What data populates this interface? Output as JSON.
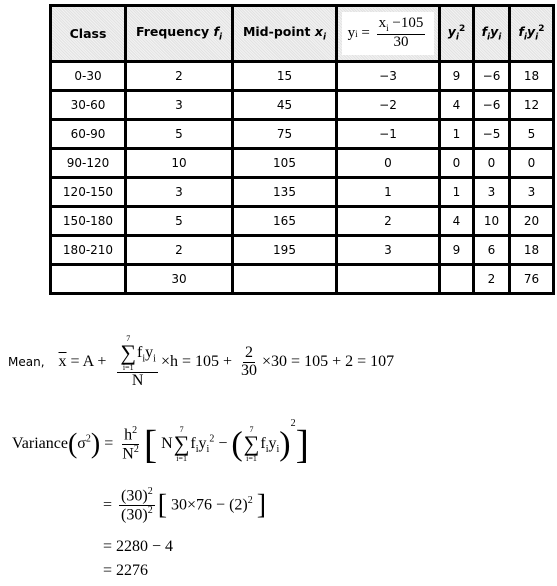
{
  "table": {
    "headers": [
      "Class",
      "Frequency",
      "Mid-point",
      "yi = (xi − 105) / 30",
      "yi²",
      "fiyi",
      "fiyi²"
    ],
    "header_parts": {
      "class": "Class",
      "frequency": "Frequency ",
      "frequency_var": "f",
      "frequency_sub": "i",
      "midpoint": "Mid-point ",
      "midpoint_var": "x",
      "midpoint_sub": "i",
      "y_lhs": "y",
      "y_lhs_sub": "i",
      "y_eq": " = ",
      "y_num_var": "x",
      "y_num_sub": "i",
      "y_num_rest": " −105",
      "y_den": "30",
      "ysq_var": "y",
      "ysq_sub": "i",
      "ysq_sup": "2",
      "fy_f": "f",
      "fy_f_sub": "i",
      "fy_y": "y",
      "fy_y_sub": "i",
      "fysq_f": "f",
      "fysq_f_sub": "i",
      "fysq_y": "y",
      "fysq_y_sub": "i",
      "fysq_sup": "2"
    },
    "rows": [
      {
        "class": "0-30",
        "f": "2",
        "x": "15",
        "y": "−3",
        "y2": "9",
        "fy": "−6",
        "fy2": "18"
      },
      {
        "class": "30-60",
        "f": "3",
        "x": "45",
        "y": "−2",
        "y2": "4",
        "fy": "−6",
        "fy2": "12"
      },
      {
        "class": "60-90",
        "f": "5",
        "x": "75",
        "y": "−1",
        "y2": "1",
        "fy": "−5",
        "fy2": "5"
      },
      {
        "class": "90-120",
        "f": "10",
        "x": "105",
        "y": "0",
        "y2": "0",
        "fy": "0",
        "fy2": "0"
      },
      {
        "class": "120-150",
        "f": "3",
        "x": "135",
        "y": "1",
        "y2": "1",
        "fy": "3",
        "fy2": "3"
      },
      {
        "class": "150-180",
        "f": "5",
        "x": "165",
        "y": "2",
        "y2": "4",
        "fy": "10",
        "fy2": "20"
      },
      {
        "class": "180-210",
        "f": "2",
        "x": "195",
        "y": "3",
        "y2": "9",
        "fy": "6",
        "fy2": "18"
      }
    ],
    "totals": {
      "class": "",
      "f": "30",
      "x": "",
      "y": "",
      "y2": "",
      "fy": "2",
      "fy2": "76"
    }
  },
  "mean": {
    "label": "Mean,",
    "xbar": "x",
    "eq_a": " = A + ",
    "sum_top": "7",
    "sum_bot": "i=1",
    "sum_term": "f",
    "sum_term_sub": "i",
    "sum_term2": "y",
    "sum_term2_sub": "i",
    "den_n": "N",
    "times_h": "×h",
    "eq1": " = 105 + ",
    "frac_num": "2",
    "frac_den": "30",
    "times30": "×30",
    "eq2": " = 105 + 2",
    "eq3": " = 107"
  },
  "variance": {
    "label": "Variance",
    "sigma": "σ",
    "sigma_sup": "2",
    "eq": " = ",
    "h2": "h",
    "h2_sup": "2",
    "n2": "N",
    "n2_sup": "2",
    "n": "N",
    "sum_top": "7",
    "sum_bot": "i=1",
    "t1": "f",
    "t1_sub": "i",
    "t2": "y",
    "t2_sub": "i",
    "t2_sup": "2",
    "minus": " − ",
    "outer_sup": "2",
    "step1_eq": "= ",
    "step1_num": "(30)",
    "step1_num_sup": "2",
    "step1_den": "(30)",
    "step1_den_sup": "2",
    "step1_body": "30×76 − (2)",
    "step1_body_sup": "2",
    "step2": "= 2280 − 4",
    "step3": "= 2276"
  }
}
